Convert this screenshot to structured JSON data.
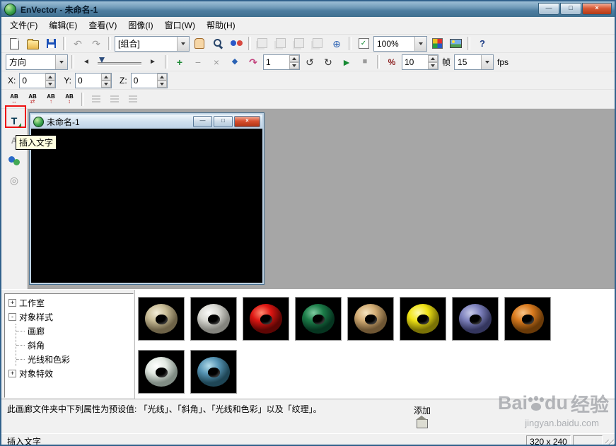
{
  "window": {
    "title": "EnVector - 未命名-1"
  },
  "menu": {
    "items": [
      "文件(F)",
      "编辑(E)",
      "查看(V)",
      "图像(I)",
      "窗口(W)",
      "帮助(H)"
    ]
  },
  "toolbar_main": {
    "group_combo": "[组合]",
    "zoom_combo": "100%"
  },
  "toolbar_anim": {
    "direction_combo": "方向",
    "current_frame": "1",
    "total_frames": "10",
    "frame_unit": "帧",
    "fps_value": "15",
    "fps_unit": "fps"
  },
  "coords": {
    "x_label": "X:",
    "x_value": "0",
    "y_label": "Y:",
    "y_value": "0",
    "z_label": "Z:",
    "z_value": "0"
  },
  "left_toolbar": {
    "tooltip": "插入文字"
  },
  "document": {
    "title": "未命名-1"
  },
  "tree": {
    "items": [
      "工作室",
      "对象样式",
      "画廊",
      "斜角",
      "光线和色彩",
      "对象特效"
    ]
  },
  "gallery": {
    "tiles": [
      {
        "name": "beige-torus",
        "base": "#c8bc96",
        "light": "#f2ecd8",
        "dark": "#6e6348"
      },
      {
        "name": "white-torus",
        "base": "#d8d8d2",
        "light": "#fbfbf9",
        "dark": "#84847e"
      },
      {
        "name": "red-torus",
        "base": "#dd1612",
        "light": "#ff8a70",
        "dark": "#5e0604"
      },
      {
        "name": "green-torus",
        "base": "#1c7c48",
        "light": "#7ecaa0",
        "dark": "#063520"
      },
      {
        "name": "tan-torus",
        "base": "#d2ac74",
        "light": "#f4e3bf",
        "dark": "#6e5634"
      },
      {
        "name": "yellow-torus",
        "base": "#efe214",
        "light": "#fdf9a8",
        "dark": "#7a7206"
      },
      {
        "name": "periwinkle-torus",
        "base": "#7e82bd",
        "light": "#c6c9e8",
        "dark": "#34365e"
      },
      {
        "name": "orange-torus",
        "base": "#d97a1e",
        "light": "#f8c488",
        "dark": "#6a3a08"
      },
      {
        "name": "pale-torus",
        "base": "#e2e9e2",
        "light": "#ffffff",
        "dark": "#808c84"
      },
      {
        "name": "steelblue-torus",
        "base": "#5795b5",
        "light": "#b3dcea",
        "dark": "#1f4656"
      }
    ]
  },
  "info_panel": {
    "description": "此画廊文件夹中下列属性为预设值: 「光线」、「斜角」、「光线和色彩」以及「纹理」。",
    "add_label": "添加"
  },
  "status_bar": {
    "message": "插入文字",
    "canvas_size": "320 x 240"
  },
  "watermark": {
    "part1": "Bai",
    "part2": "du",
    "part3": "经验",
    "url": "jingyan.baidu.com"
  },
  "annotation": {
    "highlight_color": "#ee1111"
  },
  "icons": {
    "minimize": "—",
    "maximize": "□",
    "close": "×",
    "undo": "↶",
    "redo": "↷",
    "globe": "⊕",
    "check": "✓",
    "help": "?",
    "skip_start": "◄",
    "skip_end": "►",
    "add": "+",
    "remove": "−",
    "cut": "×",
    "key": "◆",
    "loop": "↷",
    "rotate_ccw": "↺",
    "rotate_cw": "↻",
    "play": "►",
    "stop": "■",
    "percent": "%",
    "ab": "AB",
    "ab_arrow1": "↔",
    "ab_arrow2": "⇄",
    "ab_arrow3": "↑",
    "ab_arrow4": "↕",
    "text_tool": "T",
    "text_edit": "A",
    "target": "◎",
    "plus_box": "+",
    "minus_box": "-"
  }
}
